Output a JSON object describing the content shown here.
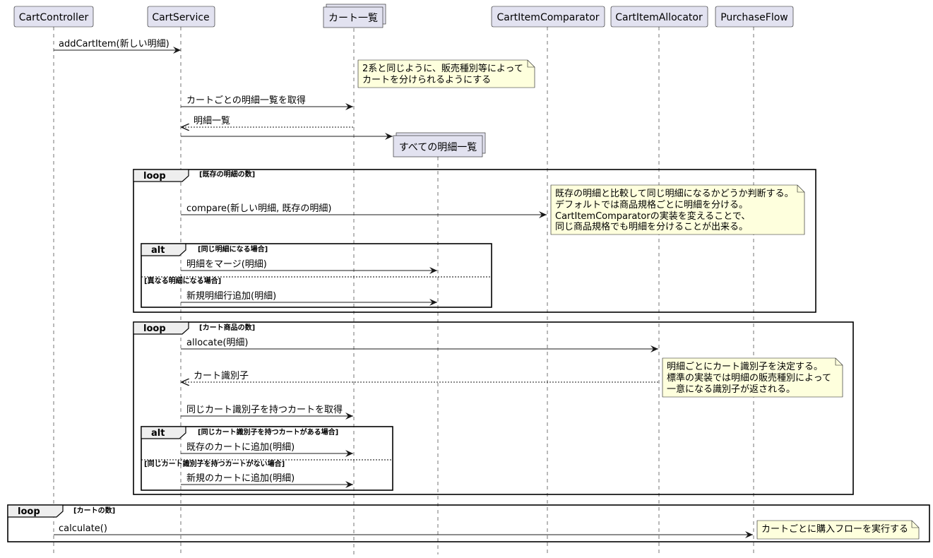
{
  "participants": [
    {
      "id": "cc",
      "label": "CartController",
      "kind": "participant"
    },
    {
      "id": "cs",
      "label": "CartService",
      "kind": "participant"
    },
    {
      "id": "cart",
      "label": "カート一覧",
      "kind": "collections"
    },
    {
      "id": "all",
      "label": "すべての明細一覧",
      "kind": "collections"
    },
    {
      "id": "cmp",
      "label": "CartItemComparator",
      "kind": "participant"
    },
    {
      "id": "alloc",
      "label": "CartItemAllocator",
      "kind": "participant"
    },
    {
      "id": "pf",
      "label": "PurchaseFlow",
      "kind": "participant"
    }
  ],
  "messages": [
    {
      "from": "cc",
      "to": "cs",
      "label": "addCartItem(新しい明細)",
      "style": "solid"
    },
    {
      "from": "cs",
      "to": "cart",
      "label": "カートごとの明細一覧を取得",
      "style": "solid"
    },
    {
      "from": "cart",
      "to": "cs",
      "label": "明細一覧",
      "style": "dashed"
    },
    {
      "from": "cs",
      "to": "all",
      "label": "",
      "style": "solid",
      "creates": true
    },
    {
      "from": "cs",
      "to": "cmp",
      "label": "compare(新しい明細, 既存の明細)",
      "style": "solid"
    },
    {
      "from": "cs",
      "to": "all",
      "label": "明細をマージ(明細)",
      "style": "solid"
    },
    {
      "from": "cs",
      "to": "all",
      "label": "新規明細行追加(明細)",
      "style": "solid"
    },
    {
      "from": "cs",
      "to": "alloc",
      "label": "allocate(明細)",
      "style": "solid"
    },
    {
      "from": "alloc",
      "to": "cs",
      "label": "カート識別子",
      "style": "dashed"
    },
    {
      "from": "cs",
      "to": "cart",
      "label": "同じカート識別子を持つカートを取得",
      "style": "solid"
    },
    {
      "from": "cs",
      "to": "cart",
      "label": "既存のカートに追加(明細)",
      "style": "solid"
    },
    {
      "from": "cs",
      "to": "cart",
      "label": "新規のカートに追加(明細)",
      "style": "solid"
    },
    {
      "from": "cc",
      "to": "pf",
      "label": "calculate()",
      "style": "solid"
    }
  ],
  "notes": [
    {
      "lines": [
        "2系と同じように、販売種別等によって",
        "カートを分けられるようにする"
      ]
    },
    {
      "lines": [
        "既存の明細と比較して同じ明細になるかどうか判断する。",
        "デフォルトでは商品規格ごとに明細を分ける。",
        "CartItemComparatorの実装を変えることで、",
        "同じ商品規格でも明細を分けることが出来る。"
      ]
    },
    {
      "lines": [
        "明細ごとにカート識別子を決定する。",
        "標準の実装では明細の販売種別によって",
        "一意になる識別子が返される。"
      ]
    },
    {
      "lines": [
        "カートごとに購入フローを実行する"
      ]
    }
  ],
  "frames": [
    {
      "kind": "loop",
      "guard": "[既存の明細の数]"
    },
    {
      "kind": "alt",
      "guard": "[同じ明細になる場合]",
      "else_guard": "[異なる明細になる場合]"
    },
    {
      "kind": "loop",
      "guard": "[カート商品の数]"
    },
    {
      "kind": "alt",
      "guard": "[同じカート識別子を持つカートがある場合]",
      "else_guard": "[同じカート識別子を持つカートがない場合]"
    },
    {
      "kind": "loop",
      "guard": "[カートの数]"
    }
  ],
  "colors": {
    "participant_fill": "#E2E2F0",
    "participant_border": "#181818",
    "note_fill": "#FEFFDD",
    "note_border": "#181818",
    "lifeline": "#181818",
    "frame_header_fill": "#EEEEEE"
  }
}
